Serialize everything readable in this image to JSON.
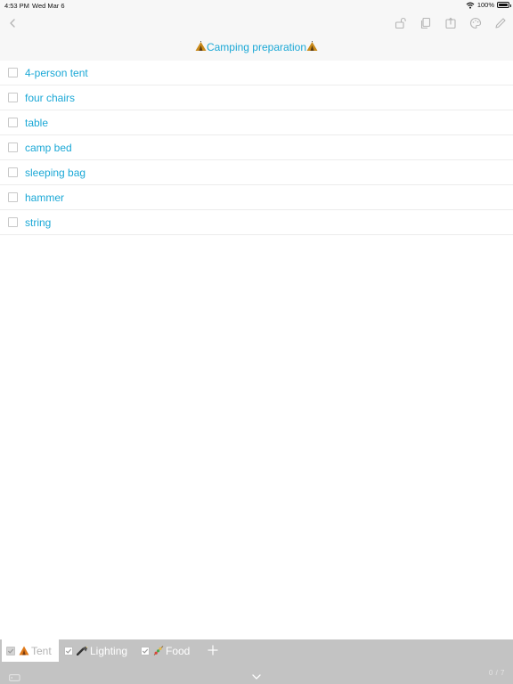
{
  "status": {
    "time": "4:53 PM",
    "date": "Wed Mar 6",
    "battery": "100%"
  },
  "navbar": {
    "title": "Camping preparation",
    "icons": [
      "back-chevron-icon",
      "lock-icon",
      "copy-icon",
      "share-icon",
      "palette-icon",
      "edit-pencil-icon"
    ]
  },
  "items": [
    {
      "label": "4-person tent",
      "checked": false
    },
    {
      "label": "four chairs",
      "checked": false
    },
    {
      "label": "table",
      "checked": false
    },
    {
      "label": "camp bed",
      "checked": false
    },
    {
      "label": "sleeping bag",
      "checked": false
    },
    {
      "label": "hammer",
      "checked": false
    },
    {
      "label": "string",
      "checked": false
    }
  ],
  "tabs": [
    {
      "label": "Tent",
      "active": true
    },
    {
      "label": "Lighting",
      "active": false
    },
    {
      "label": "Food",
      "active": false
    }
  ],
  "footer": {
    "counter": "0 / 7"
  },
  "colors": {
    "accent": "#1ba8d6",
    "bar_gray": "#c3c3c3",
    "nav_bg": "#f7f7f7"
  }
}
